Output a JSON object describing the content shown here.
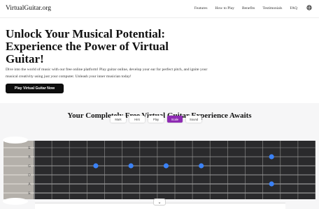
{
  "nav": {
    "logo": "VirtualGuitar.org",
    "links": [
      "Features",
      "How to Play",
      "Benefits",
      "Testimonials",
      "FAQ"
    ],
    "language_icon": "globe-icon"
  },
  "hero": {
    "title": "Unlock Your Musical Potential: Experience the Power of Virtual Guitar!",
    "description": "Dive into the world of music with our free online platform! Play guitar online, develop your ear for perfect pitch, and ignite your musical creativity using just your computer. Unleash your inner musician today!",
    "cta": "Play Virtual Guitar Now"
  },
  "experience": {
    "title": "Your Completely Free Virtual Guitar Experience Awaits",
    "modes": [
      "Mark",
      "Hint",
      "Play",
      "Scale",
      "Sound"
    ],
    "active_mode": "Scale",
    "active_color": "#8e2bb3"
  },
  "fretboard": {
    "strings": [
      "E",
      "B",
      "G",
      "D",
      "A",
      "E"
    ],
    "frets": 16,
    "marker_color": "#3b82f6",
    "markers": [
      {
        "string": 2,
        "fret": 14
      },
      {
        "string": 3,
        "fret": 4
      },
      {
        "string": 3,
        "fret": 6
      },
      {
        "string": 3,
        "fret": 8
      },
      {
        "string": 3,
        "fret": 10
      },
      {
        "string": 5,
        "fret": 14
      }
    ]
  },
  "expand_icon": "chevron-down-icon",
  "expand_glyph": "⌄"
}
